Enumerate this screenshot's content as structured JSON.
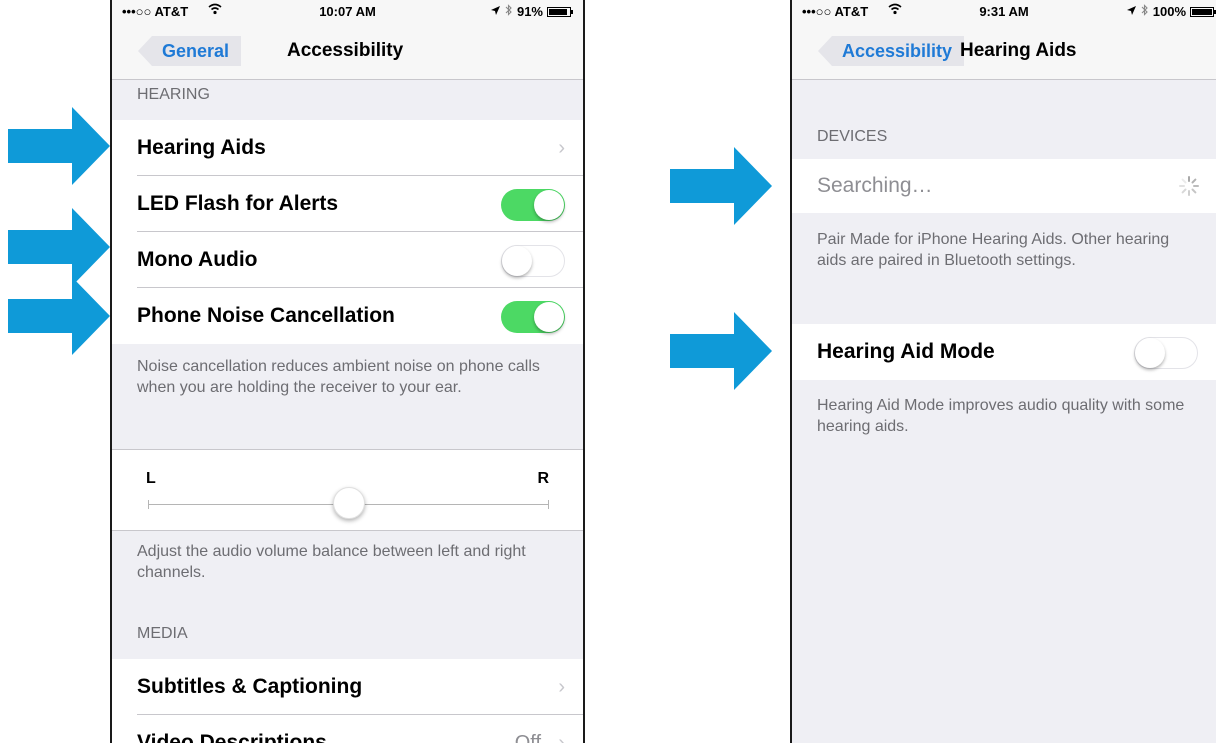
{
  "left": {
    "status": {
      "carrier": "•••○○ AT&T",
      "time": "10:07 AM",
      "battery": "91%",
      "battery_level": 0.91
    },
    "nav": {
      "back": "General",
      "title": "Accessibility"
    },
    "hearing": {
      "header": "HEARING",
      "hearing_aids": "Hearing Aids",
      "led_flash": "LED Flash for Alerts",
      "mono_audio": "Mono Audio",
      "noise_cancel": "Phone Noise Cancellation",
      "footer": "Noise cancellation reduces ambient noise on phone calls when you are holding the receiver to your ear."
    },
    "balance": {
      "left_label": "L",
      "right_label": "R",
      "value": 0.5,
      "footer": "Adjust the audio volume balance between left and right channels."
    },
    "media": {
      "header": "MEDIA",
      "subtitles": "Subtitles & Captioning",
      "video_desc": "Video Descriptions",
      "video_desc_value": "Off"
    },
    "toggles": {
      "led_flash": true,
      "mono_audio": false,
      "noise_cancel": true
    }
  },
  "right": {
    "status": {
      "carrier": "•••○○ AT&T",
      "time": "9:31 AM",
      "battery": "100%",
      "battery_level": 1.0
    },
    "nav": {
      "back": "Accessibility",
      "title": "Hearing Aids"
    },
    "devices": {
      "header": "DEVICES",
      "searching": "Searching…",
      "footer": "Pair Made for iPhone Hearing Aids. Other hearing aids are paired in Bluetooth settings."
    },
    "mode": {
      "label": "Hearing Aid Mode",
      "enabled": false,
      "footer": "Hearing Aid Mode improves audio quality with some hearing aids."
    }
  },
  "colors": {
    "arrow": "#0f9ad8",
    "switch_on": "#4cd964",
    "ios_blue": "#1f7ad6"
  },
  "icons": {
    "chevron": "›",
    "wifi": "wifi-icon",
    "location": "location-arrow-icon",
    "bluetooth": "bluetooth-icon",
    "battery": "battery-icon",
    "spinner": "activity-spinner-icon",
    "arrow": "right-arrow-icon"
  }
}
